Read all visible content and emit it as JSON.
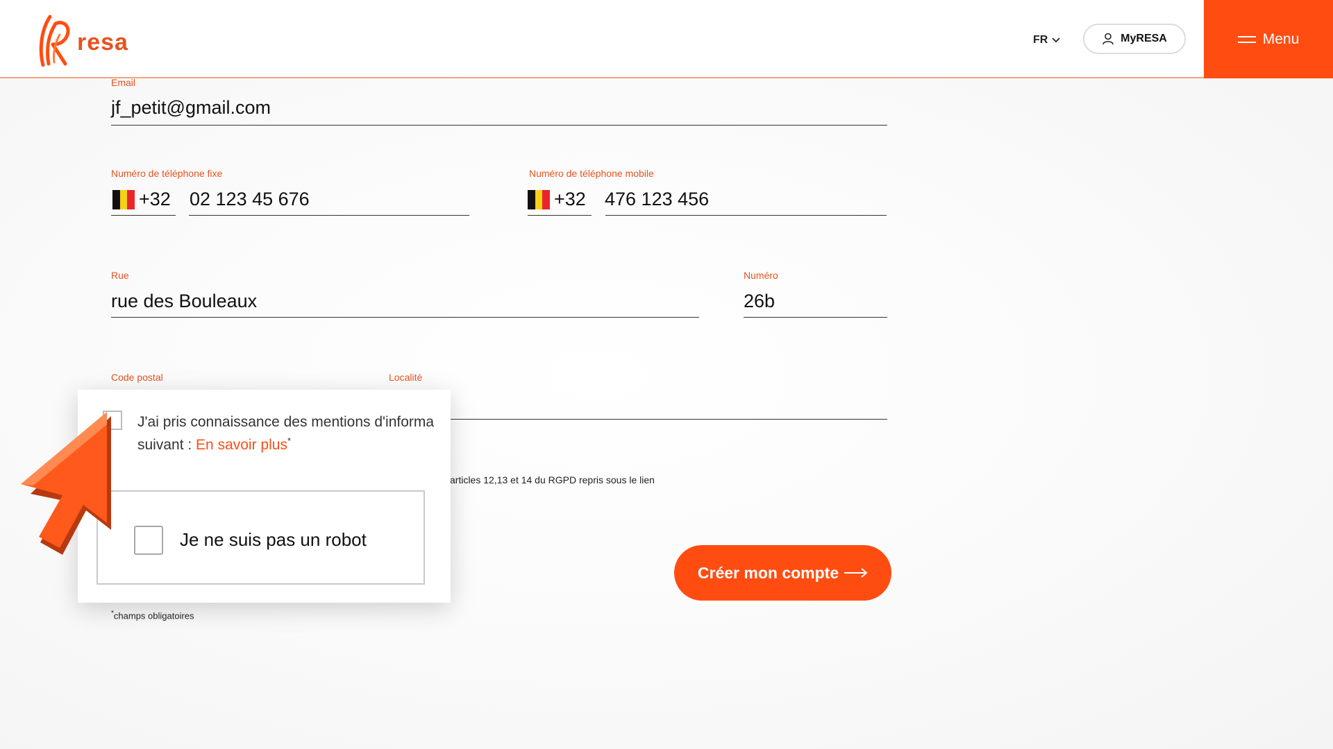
{
  "colors": {
    "accent": "#ff4d12",
    "accent_text": "#e8521e",
    "header_bg": "#ffffff",
    "text": "#111111"
  },
  "header": {
    "logo_text": "resa",
    "lang": "FR",
    "myresa_label": "MyRESA",
    "menu_label": "Menu"
  },
  "form": {
    "email": {
      "label": "Email",
      "value": "jf_petit@gmail.com"
    },
    "phone_fixed": {
      "label": "Numéro de téléphone fixe",
      "country_code": "+32",
      "value": "02 123 45 676"
    },
    "phone_mobile": {
      "label": "Numéro de téléphone mobile",
      "country_code": "+32",
      "value": "476 123 456"
    },
    "street": {
      "label": "Rue",
      "value": "rue des Bouleaux"
    },
    "number": {
      "label": "Numéro",
      "value": "26b"
    },
    "postal_code": {
      "label": "Code postal",
      "value": ""
    },
    "locality": {
      "label": "Localité",
      "value": ""
    },
    "rgpd_partial": "articles 12,13 et 14 du RGPD repris sous le lien",
    "required_note": "champs obligatoires",
    "submit_label": "Créer mon compte"
  },
  "zoom_overlay": {
    "consent_line1": "J'ai pris connaissance des mentions d'informa",
    "consent_line2_prefix": "suivant : ",
    "consent_link": "En savoir plus",
    "consent_asterisk": "*",
    "captcha_label": "Je ne suis pas un robot"
  }
}
